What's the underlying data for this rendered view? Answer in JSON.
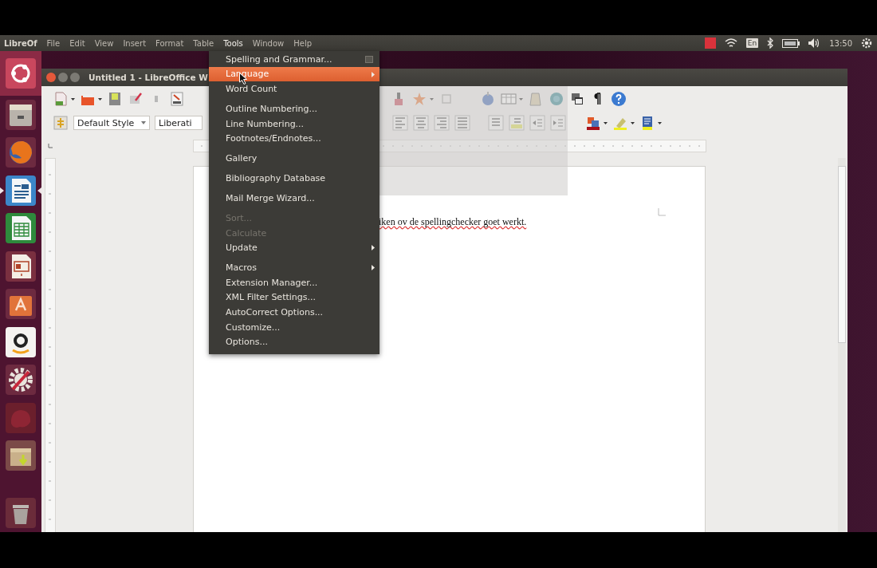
{
  "top_panel": {
    "app_name": "LibreOf",
    "menus": [
      {
        "label": "File",
        "selected": false
      },
      {
        "label": "Edit",
        "selected": false
      },
      {
        "label": "View",
        "selected": false
      },
      {
        "label": "Insert",
        "selected": false
      },
      {
        "label": "Format",
        "selected": false
      },
      {
        "label": "Table",
        "selected": false
      },
      {
        "label": "Tools",
        "selected": true
      },
      {
        "label": "Window",
        "selected": false
      },
      {
        "label": "Help",
        "selected": false
      }
    ],
    "keyboard_layout": "En",
    "clock": "13:50"
  },
  "launcher": [
    {
      "kind": "home",
      "active": false
    },
    {
      "kind": "files",
      "active": false
    },
    {
      "kind": "browser",
      "active": false
    },
    {
      "kind": "writer",
      "active": true
    },
    {
      "kind": "calc",
      "active": false
    },
    {
      "kind": "impress",
      "active": false
    },
    {
      "kind": "software",
      "active": false
    },
    {
      "kind": "shop",
      "active": false
    },
    {
      "kind": "settings",
      "active": false
    },
    {
      "kind": "red",
      "active": false
    },
    {
      "kind": "package",
      "active": false
    },
    {
      "kind": "trash",
      "active": false
    }
  ],
  "window": {
    "title": "Untitled 1 - LibreOffice W"
  },
  "formatting": {
    "paragraph_style": "Default Style",
    "font_name": "Liberati"
  },
  "document": {
    "text": "iken ov de spellingchecker goet werkt."
  },
  "tools_menu": [
    {
      "kind": "item",
      "label": "Spelling and Grammar...",
      "selected": false,
      "disabled": false,
      "submenu": false,
      "icon": true
    },
    {
      "kind": "item",
      "label": "Language",
      "selected": true,
      "disabled": false,
      "submenu": true
    },
    {
      "kind": "item",
      "label": "Word Count",
      "selected": false,
      "disabled": false,
      "submenu": false
    },
    {
      "kind": "separator"
    },
    {
      "kind": "item",
      "label": "Outline Numbering...",
      "selected": false,
      "disabled": false,
      "submenu": false
    },
    {
      "kind": "item",
      "label": "Line Numbering...",
      "selected": false,
      "disabled": false,
      "submenu": false
    },
    {
      "kind": "item",
      "label": "Footnotes/Endnotes...",
      "selected": false,
      "disabled": false,
      "submenu": false
    },
    {
      "kind": "separator"
    },
    {
      "kind": "item",
      "label": "Gallery",
      "selected": false,
      "disabled": false,
      "submenu": false
    },
    {
      "kind": "separator"
    },
    {
      "kind": "item",
      "label": "Bibliography Database",
      "selected": false,
      "disabled": false,
      "submenu": false
    },
    {
      "kind": "separator"
    },
    {
      "kind": "item",
      "label": "Mail Merge Wizard...",
      "selected": false,
      "disabled": false,
      "submenu": false
    },
    {
      "kind": "separator"
    },
    {
      "kind": "item",
      "label": "Sort...",
      "selected": false,
      "disabled": true,
      "submenu": false
    },
    {
      "kind": "item",
      "label": "Calculate",
      "selected": false,
      "disabled": true,
      "submenu": false
    },
    {
      "kind": "item",
      "label": "Update",
      "selected": false,
      "disabled": false,
      "submenu": true
    },
    {
      "kind": "separator"
    },
    {
      "kind": "item",
      "label": "Macros",
      "selected": false,
      "disabled": false,
      "submenu": true
    },
    {
      "kind": "item",
      "label": "Extension Manager...",
      "selected": false,
      "disabled": false,
      "submenu": false
    },
    {
      "kind": "item",
      "label": "XML Filter Settings...",
      "selected": false,
      "disabled": false,
      "submenu": false
    },
    {
      "kind": "item",
      "label": "AutoCorrect Options...",
      "selected": false,
      "disabled": false,
      "submenu": false
    },
    {
      "kind": "item",
      "label": "Customize...",
      "selected": false,
      "disabled": false,
      "submenu": false
    },
    {
      "kind": "item",
      "label": "Options...",
      "selected": false,
      "disabled": false,
      "submenu": false
    }
  ]
}
